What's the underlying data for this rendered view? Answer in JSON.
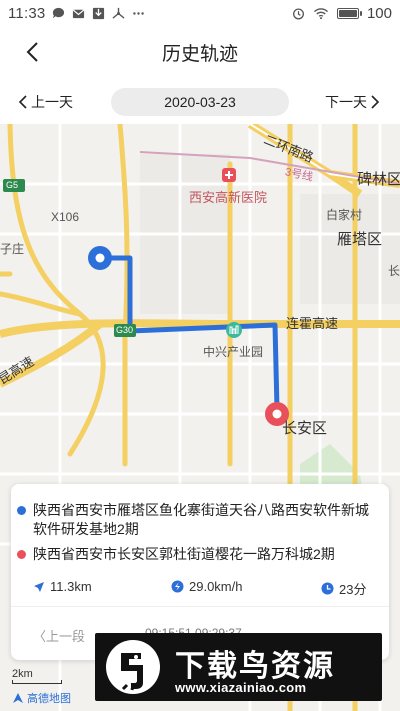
{
  "status_bar": {
    "time": "11:33",
    "battery_percent": "100",
    "left_icons": [
      "chat-bubble-icon",
      "mail-icon",
      "download-icon",
      "hub-icon",
      "more-dots-icon"
    ],
    "right_icons": [
      "alarm-icon",
      "wifi-icon",
      "battery-icon"
    ]
  },
  "header": {
    "title": "历史轨迹",
    "back_icon": "chevron-left-icon"
  },
  "date_nav": {
    "prev_label": "上一天",
    "next_label": "下一天",
    "date": "2020-03-23"
  },
  "map": {
    "labels": {
      "hospital": "西安高新医院",
      "ring_road": "二环南路",
      "metro_line": "3号线",
      "beilin": "碑林区",
      "baijiacun": "白家村",
      "yanta": "雁塔区",
      "x106": "X106",
      "g5": "G5",
      "g30": "G30",
      "lianhuo": "连霍高速",
      "zhongxing": "中兴产业园",
      "changan": "长安区",
      "zi": "子庄",
      "gao": "昆高速",
      "chang": "长"
    },
    "track_color": "#2d6fd8",
    "start_marker_color": "#2d6fd8",
    "end_marker_color": "#e8505b"
  },
  "info_card": {
    "start_address": "陕西省西安市雁塔区鱼化寨街道天谷八路西安软件新城软件研发基地2期",
    "end_address": "陕西省西安市长安区郭杜街道樱花一路万科城2期",
    "distance": "11.3km",
    "speed": "29.0km/h",
    "duration": "23分",
    "prev_segment": "上一段",
    "segment_time": "09:15:51 09:29:37"
  },
  "map_footer": {
    "scale": "2km",
    "provider": "高德地图"
  },
  "watermark": {
    "title": "下载鸟资源",
    "url": "www.xiazainiao.com"
  }
}
